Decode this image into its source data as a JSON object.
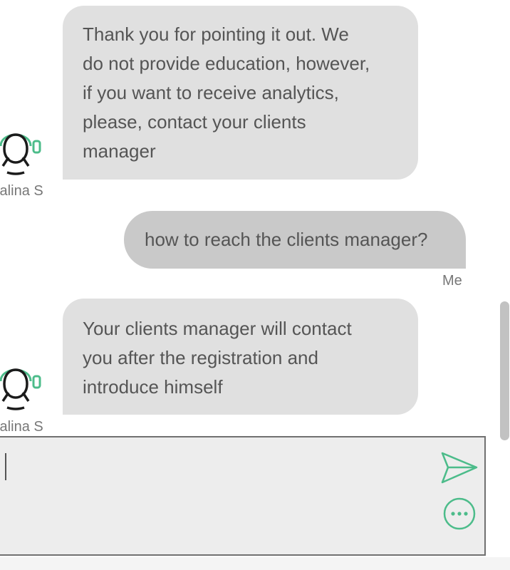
{
  "messages": [
    {
      "sender": "Galina S",
      "lines": [
        "Thank you for pointing it out. We",
        "do not provide education, however,",
        "if you want to receive analytics,",
        "please, contact your clients",
        "manager"
      ]
    },
    {
      "sender": "Me",
      "text": "how to reach the clients manager?"
    },
    {
      "sender": "Galina S",
      "lines": [
        "Your clients manager will contact",
        "you after the registration and",
        "introduce himself"
      ]
    }
  ],
  "composer": {
    "value": "",
    "send_icon": "send-icon",
    "more_icon": "more-options-icon"
  },
  "colors": {
    "accent": "#4cbc8a",
    "agent_bubble": "#e0e0e0",
    "user_bubble": "#c9c9c9",
    "text": "#555555"
  },
  "icons": {
    "avatar": "support-agent-headset-icon"
  }
}
